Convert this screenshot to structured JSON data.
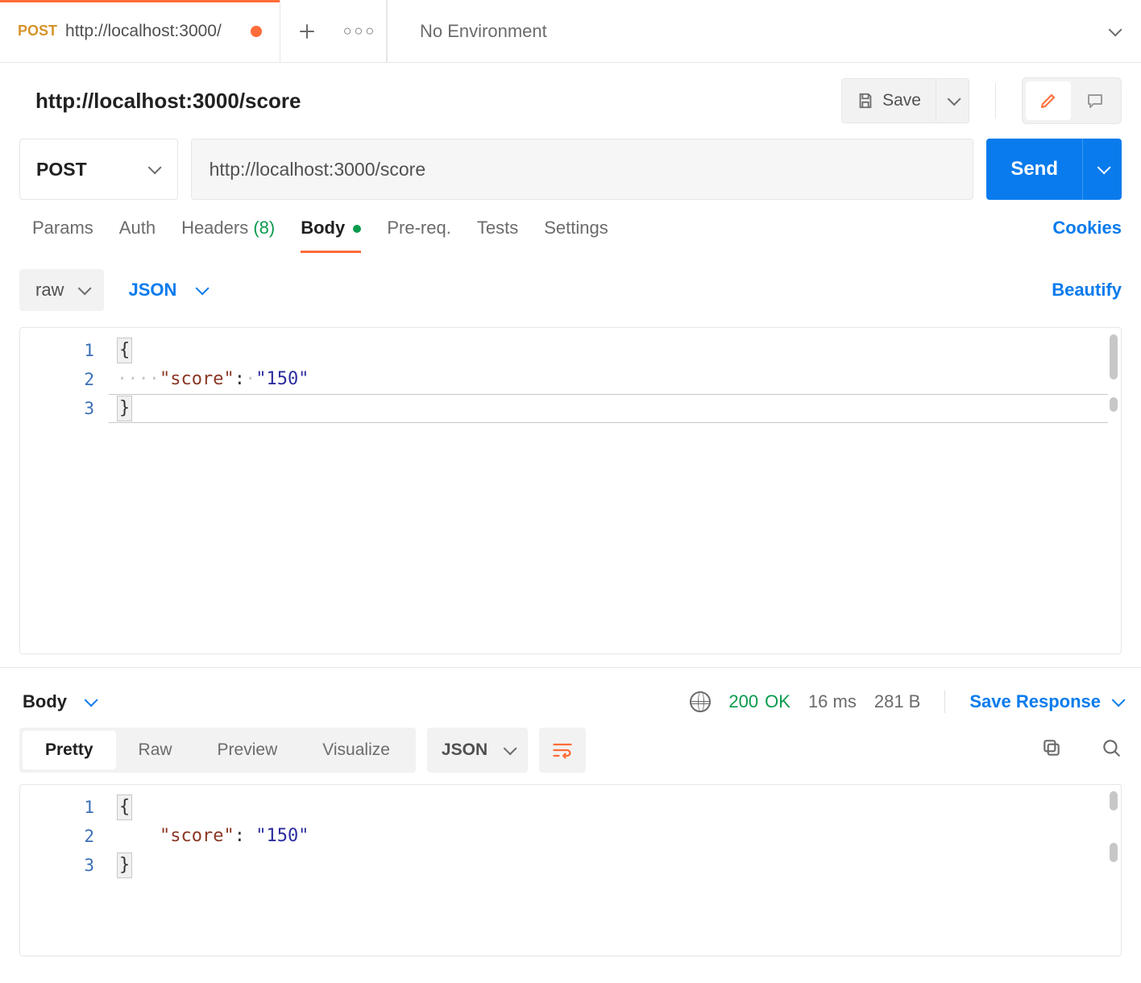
{
  "tab": {
    "method": "POST",
    "title": "http://localhost:3000/",
    "unsaved": true
  },
  "environment": "No Environment",
  "request": {
    "title": "http://localhost:3000/score",
    "method": "POST",
    "url": "http://localhost:3000/score",
    "save_label": "Save",
    "send_label": "Send"
  },
  "request_tabs": {
    "params": "Params",
    "auth": "Auth",
    "headers_label": "Headers",
    "headers_count": "(8)",
    "body": "Body",
    "prereq": "Pre-req.",
    "tests": "Tests",
    "settings": "Settings",
    "cookies": "Cookies"
  },
  "body_toolbar": {
    "mode": "raw",
    "format": "JSON",
    "beautify": "Beautify"
  },
  "request_body": {
    "lines": [
      "1",
      "2",
      "3"
    ],
    "line1_open": "{",
    "line2_indent": "····",
    "line2_key": "\"score\"",
    "line2_colon": ":",
    "line2_dot": "·",
    "line2_val": "\"150\"",
    "line3_close": "}"
  },
  "response": {
    "section_label": "Body",
    "status_code": "200",
    "status_text": "OK",
    "time": "16 ms",
    "size": "281 B",
    "save_label": "Save Response",
    "view_tabs": {
      "pretty": "Pretty",
      "raw": "Raw",
      "preview": "Preview",
      "visualize": "Visualize"
    },
    "format": "JSON"
  },
  "response_body": {
    "lines": [
      "1",
      "2",
      "3"
    ],
    "line1_open": "{",
    "line2_indent": "    ",
    "line2_key": "\"score\"",
    "line2_colon": ":",
    "line2_val": "\"150\"",
    "line3_close": "}"
  }
}
